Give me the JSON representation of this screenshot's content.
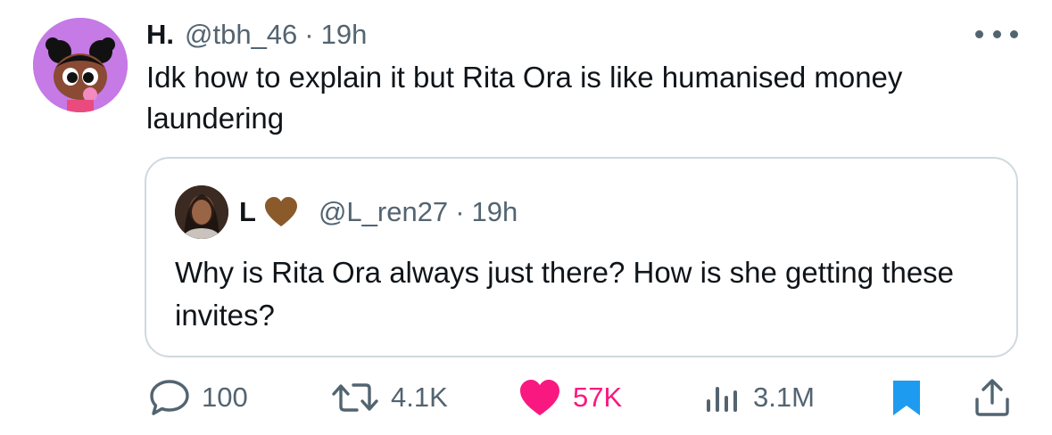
{
  "tweet": {
    "display_name": "H.",
    "handle": "@tbh_46",
    "separator": "·",
    "time": "19h",
    "text": "Idk how to explain it but Rita Ora is like humanised money laundering"
  },
  "quote": {
    "display_name": "L",
    "handle": "@L_ren27",
    "separator": "·",
    "time": "19h",
    "text": "Why is Rita Ora always just there? How is she getting these invites?"
  },
  "actions": {
    "replies": "100",
    "retweets": "4.1K",
    "likes": "57K",
    "views": "3.1M"
  },
  "icons": {
    "reply": "reply-icon",
    "retweet": "retweet-icon",
    "like": "heart-icon",
    "views": "views-icon",
    "bookmark": "bookmark-icon",
    "share": "share-icon",
    "more": "more-icon",
    "name_badge": "brown-heart-icon"
  },
  "colors": {
    "text": "#0f1419",
    "secondary": "#536471",
    "like": "#f91880",
    "bookmark": "#1d9bf0",
    "border": "#cfd9de",
    "brown_heart": "#8a5a2b"
  }
}
